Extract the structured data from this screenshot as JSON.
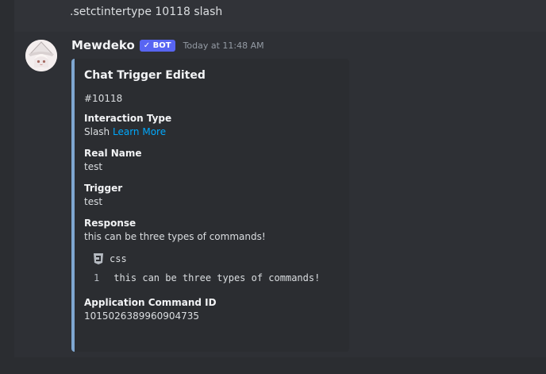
{
  "previous_message": ".setctintertype 10118 slash",
  "message": {
    "username": "Mewdeko",
    "bot_badge": "✓ BOT",
    "timestamp": "Today at 11:48 AM"
  },
  "embed": {
    "accent_color": "#7fa7d1",
    "title": "Chat Trigger Edited",
    "description": "#10118",
    "fields": [
      {
        "name": "Interaction Type",
        "value": "Slash",
        "link": "Learn More"
      },
      {
        "name": "Real Name",
        "value": "test"
      },
      {
        "name": "Trigger",
        "value": "test"
      },
      {
        "name": "Response",
        "value": "this can be three types of commands!"
      }
    ],
    "code": {
      "language": "css",
      "icon": "css-file-icon",
      "lines": [
        {
          "num": "1",
          "text": "this can be three types of commands!"
        }
      ]
    },
    "app_command": {
      "name": "Application Command ID",
      "value": "1015026389960904735"
    }
  },
  "colors": {
    "background": "#313338",
    "sidebar": "#2b2d31",
    "link": "#00a8fc",
    "badge": "#5865f2"
  }
}
